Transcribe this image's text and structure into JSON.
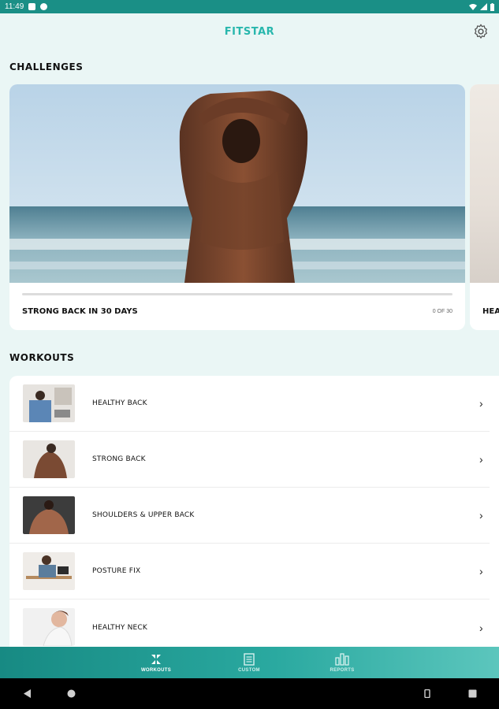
{
  "status_bar": {
    "time": "11:49"
  },
  "app_bar": {
    "title": "FITSTAR",
    "settings_icon": "gear-icon"
  },
  "challenges": {
    "section_title": "CHALLENGES",
    "cards": [
      {
        "name": "STRONG BACK IN 30 DAYS",
        "progress_label": "0 OF 30",
        "progress_fraction": 0
      },
      {
        "name": "HEA"
      }
    ]
  },
  "workouts": {
    "section_title": "WORKOUTS",
    "items": [
      {
        "label": "HEALTHY BACK"
      },
      {
        "label": "STRONG BACK"
      },
      {
        "label": "SHOULDERS & UPPER BACK"
      },
      {
        "label": "POSTURE FIX"
      },
      {
        "label": "HEALTHY NECK"
      }
    ]
  },
  "bottom_nav": {
    "items": [
      {
        "label": "WORKOUTS",
        "icon": "workouts-icon",
        "active": true
      },
      {
        "label": "CUSTOM",
        "icon": "custom-icon",
        "active": false
      },
      {
        "label": "REPORTS",
        "icon": "reports-icon",
        "active": false
      }
    ]
  },
  "colors": {
    "accent": "#28b7ad",
    "status_bar": "#1a8f86",
    "background": "#eaf6f5"
  }
}
